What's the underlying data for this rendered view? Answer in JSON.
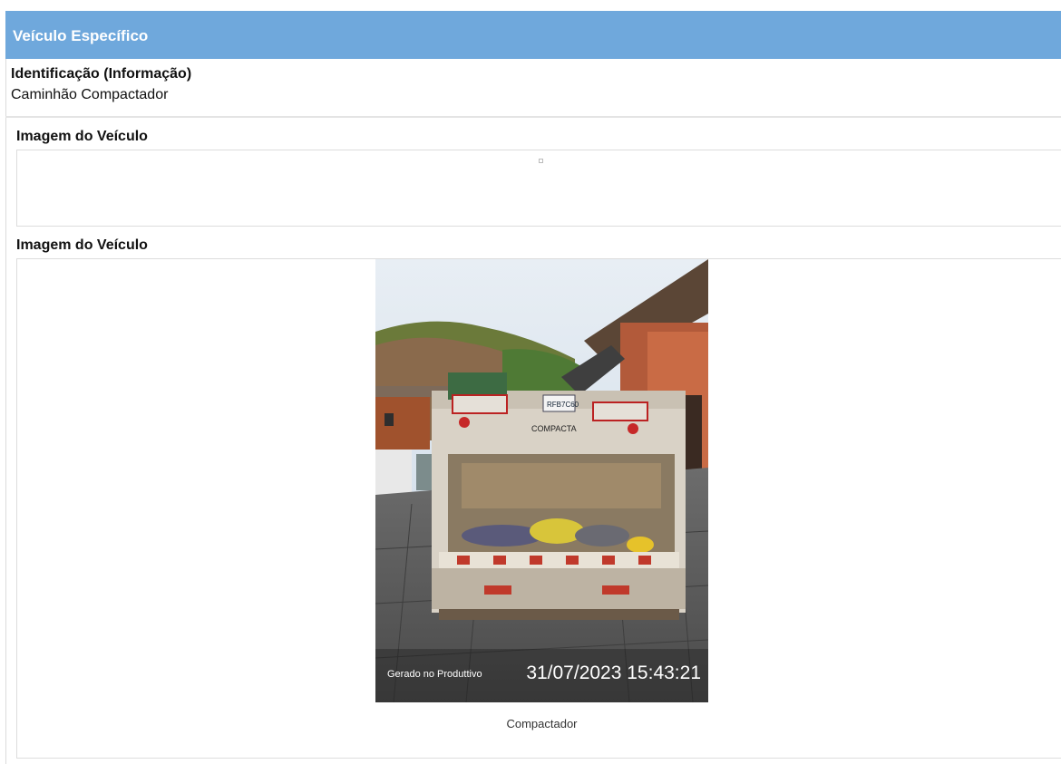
{
  "header": {
    "title": "Veículo Específico"
  },
  "identification": {
    "label": "Identificação (Informação)",
    "value": "Caminhão Compactador"
  },
  "images": [
    {
      "label": "Imagem do Veículo",
      "state": "broken"
    },
    {
      "label": "Imagem do Veículo",
      "photo_stamp_text": "Gerado no Produttivo",
      "photo_stamp_datetime": "31/07/2023 15:43:21",
      "plate_text": "RFB7C60",
      "brand_text": "COMPACTA",
      "caption": "Compactador"
    }
  ],
  "colors": {
    "header_bg": "#6fa8dc",
    "header_text": "#ffffff"
  }
}
